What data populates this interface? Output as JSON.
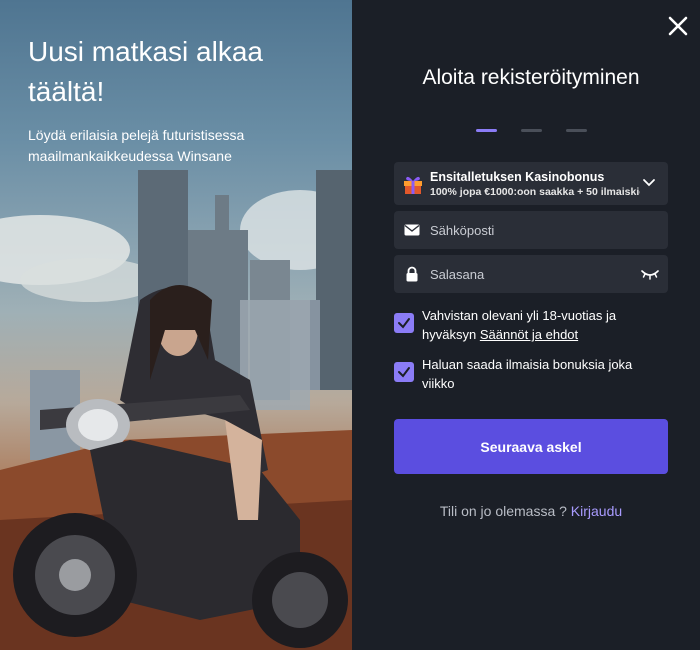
{
  "hero": {
    "title": "Uusi matkasi alkaa täältä!",
    "subtitle": "Löydä erilaisia pelejä futuristisessa maailmankaikkeudessa Winsane"
  },
  "form": {
    "title": "Aloita rekisteröityminen",
    "steps": {
      "total": 3,
      "current": 1
    },
    "bonus": {
      "icon": "gift-icon",
      "title": "Ensitalletuksen Kasinobonus",
      "description": "100% jopa €1000:oon saakka + 50 ilmaiskierrosta"
    },
    "email": {
      "placeholder": "Sähköposti",
      "icon": "envelope-icon"
    },
    "password": {
      "placeholder": "Salasana",
      "icon": "lock-icon"
    },
    "terms": {
      "checked": true,
      "text": "Vahvistan olevani yli 18-vuotias ja hyväksyn",
      "link": "Säännöt ja ehdot"
    },
    "bonuses_optin": {
      "checked": true,
      "text": "Haluan saada ilmaisia bonuksia joka viikko"
    },
    "submit_label": "Seuraava askel",
    "login_prompt": "Tili on jo olemassa ?",
    "login_link": "Kirjaudu"
  },
  "colors": {
    "accent": "#8b7cf6",
    "button": "#5b4ee0",
    "panel": "#1b1f27",
    "field": "#2a2e37"
  }
}
